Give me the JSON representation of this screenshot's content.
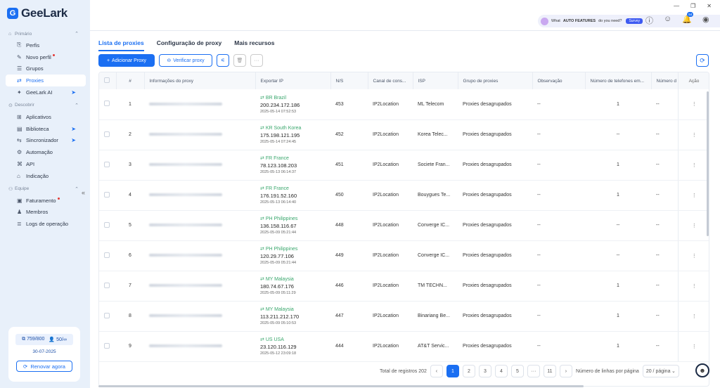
{
  "app": {
    "name": "GeeLark"
  },
  "window": {
    "min_icon": "minimize-icon",
    "restore_icon": "restore-icon",
    "close_icon": "close-icon"
  },
  "sidebar": {
    "sections": [
      {
        "label": "Primário",
        "items": [
          {
            "label": "Perfis",
            "icon": "profiles-icon"
          },
          {
            "label": "Novo perfil",
            "icon": "new-profile-icon",
            "dot": true
          },
          {
            "label": "Grupos",
            "icon": "groups-icon"
          },
          {
            "label": "Proxies",
            "icon": "proxies-icon",
            "active": true
          },
          {
            "label": "GeeLark AI",
            "icon": "ai-icon",
            "pin": true
          }
        ]
      },
      {
        "label": "Descobrir",
        "items": [
          {
            "label": "Aplicativos",
            "icon": "apps-icon"
          },
          {
            "label": "Biblioteca",
            "icon": "library-icon",
            "pin": true
          },
          {
            "label": "Sincronizador",
            "icon": "sync-icon",
            "pin": true
          },
          {
            "label": "Automação",
            "icon": "automation-icon"
          },
          {
            "label": "API",
            "icon": "api-icon"
          },
          {
            "label": "Indicação",
            "icon": "referral-icon"
          }
        ]
      },
      {
        "label": "Equipe",
        "items": [
          {
            "label": "Faturamento",
            "icon": "billing-icon",
            "dot": true
          },
          {
            "label": "Membros",
            "icon": "members-icon"
          },
          {
            "label": "Logs de operação",
            "icon": "logs-icon"
          }
        ]
      }
    ],
    "plan": {
      "profiles": "759/800",
      "members": "50/∞",
      "expiry": "30-07-2025",
      "renew_label": "Renovar agora"
    }
  },
  "topbar": {
    "promo_prefix": "What",
    "promo_bold": "AUTO FEATURES",
    "promo_suffix": "do you need?",
    "survey_label": "Survey",
    "notification_count": "54"
  },
  "tabs": [
    "Lista de proxies",
    "Configuração de proxy",
    "Mais recursos"
  ],
  "toolbar": {
    "add_label": "Adicionar Proxy",
    "verify_label": "Verificar proxy"
  },
  "table": {
    "columns": [
      "#",
      "Informações do proxy",
      "Exportar IP",
      "N/S",
      "Canal de cons...",
      "ISP",
      "Grupo de proxies",
      "Observação",
      "Número de telefones em...",
      "Número d",
      "Ação"
    ],
    "rows": [
      {
        "n": "1",
        "country": "BR Brazil",
        "ip": "200.234.172.186",
        "ts": "2025-05-14 07:52:53",
        "ns": "453",
        "channel": "IP2Location",
        "isp": "ML Telecom",
        "group": "Proxies desagrupados",
        "obs": "--",
        "phones": "1",
        "num": "--"
      },
      {
        "n": "2",
        "country": "KR South Korea",
        "ip": "175.198.121.195",
        "ts": "2025-05-14 07:24:45",
        "ns": "452",
        "channel": "IP2Location",
        "isp": "Korea Telec...",
        "group": "Proxies desagrupados",
        "obs": "--",
        "phones": "--",
        "num": "--"
      },
      {
        "n": "3",
        "country": "FR France",
        "ip": "78.123.108.203",
        "ts": "2025-05-13 06:14:37",
        "ns": "451",
        "channel": "IP2Location",
        "isp": "Societe Fran...",
        "group": "Proxies desagrupados",
        "obs": "--",
        "phones": "1",
        "num": "--"
      },
      {
        "n": "4",
        "country": "FR France",
        "ip": "176.191.52.160",
        "ts": "2025-05-13 06:14:40",
        "ns": "450",
        "channel": "IP2Location",
        "isp": "Bouygues Te...",
        "group": "Proxies desagrupados",
        "obs": "--",
        "phones": "1",
        "num": "--"
      },
      {
        "n": "5",
        "country": "PH Philippines",
        "ip": "136.158.116.67",
        "ts": "2025-05-09 05:21:44",
        "ns": "448",
        "channel": "IP2Location",
        "isp": "Converge IC...",
        "group": "Proxies desagrupados",
        "obs": "--",
        "phones": "--",
        "num": "--"
      },
      {
        "n": "6",
        "country": "PH Philippines",
        "ip": "120.29.77.106",
        "ts": "2025-05-09 05:21:44",
        "ns": "449",
        "channel": "IP2Location",
        "isp": "Converge IC...",
        "group": "Proxies desagrupados",
        "obs": "--",
        "phones": "--",
        "num": "--"
      },
      {
        "n": "7",
        "country": "MY Malaysia",
        "ip": "180.74.67.176",
        "ts": "2025-05-09 05:11:29",
        "ns": "446",
        "channel": "IP2Location",
        "isp": "TM TECHN...",
        "group": "Proxies desagrupados",
        "obs": "--",
        "phones": "1",
        "num": "--"
      },
      {
        "n": "8",
        "country": "MY Malaysia",
        "ip": "113.211.212.170",
        "ts": "2025-05-09 05:10:53",
        "ns": "447",
        "channel": "IP2Location",
        "isp": "Binariang Be...",
        "group": "Proxies desagrupados",
        "obs": "--",
        "phones": "1",
        "num": "--"
      },
      {
        "n": "9",
        "country": "US USA",
        "ip": "23.120.116.129",
        "ts": "2025-05-12 23:09:18",
        "ns": "444",
        "channel": "IP2Location",
        "isp": "AT&T Servic...",
        "group": "Proxies desagrupados",
        "obs": "--",
        "phones": "1",
        "num": "--"
      }
    ]
  },
  "pagination": {
    "total_label": "Total de registros 202",
    "pages": [
      "1",
      "2",
      "3",
      "4",
      "5",
      "···",
      "11"
    ],
    "rows_label": "Número de linhas por página",
    "page_size": "20 / página"
  },
  "colors": {
    "accent": "#1b6ff2",
    "country": "#3aa76d",
    "dot": "#e53935"
  }
}
